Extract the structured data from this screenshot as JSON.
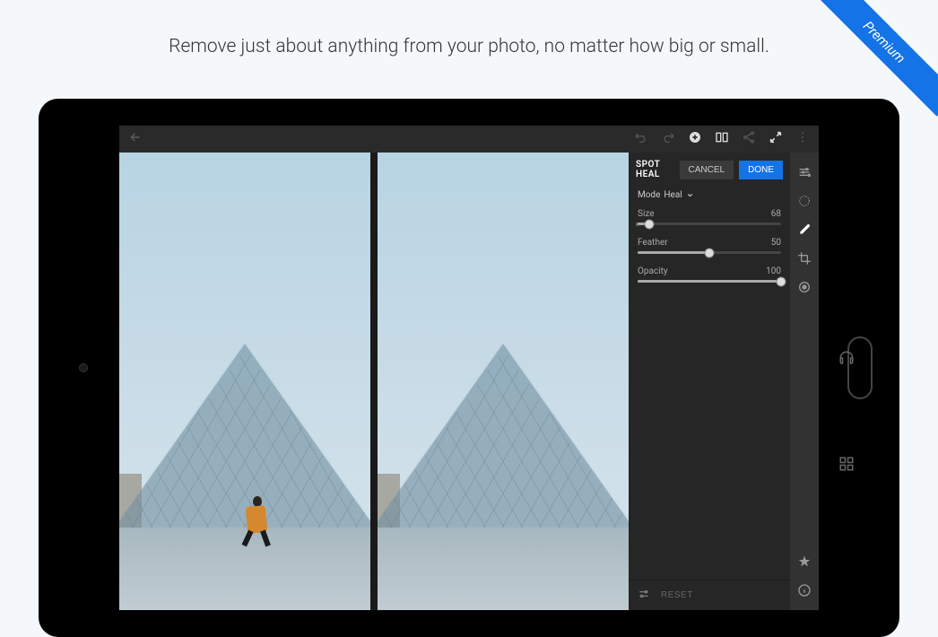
{
  "headline": "Remove just about anything from your photo, no matter how big or small.",
  "ribbon": "Premium",
  "panel": {
    "title": "SPOT HEAL",
    "cancel": "CANCEL",
    "done": "DONE",
    "mode_label": "Mode",
    "mode_value": "Heal",
    "sliders": {
      "size": {
        "label": "Size",
        "value": "68",
        "pct": 8
      },
      "feather": {
        "label": "Feather",
        "value": "50",
        "pct": 50
      },
      "opacity": {
        "label": "Opacity",
        "value": "100",
        "pct": 100
      }
    },
    "reset": "RESET"
  }
}
